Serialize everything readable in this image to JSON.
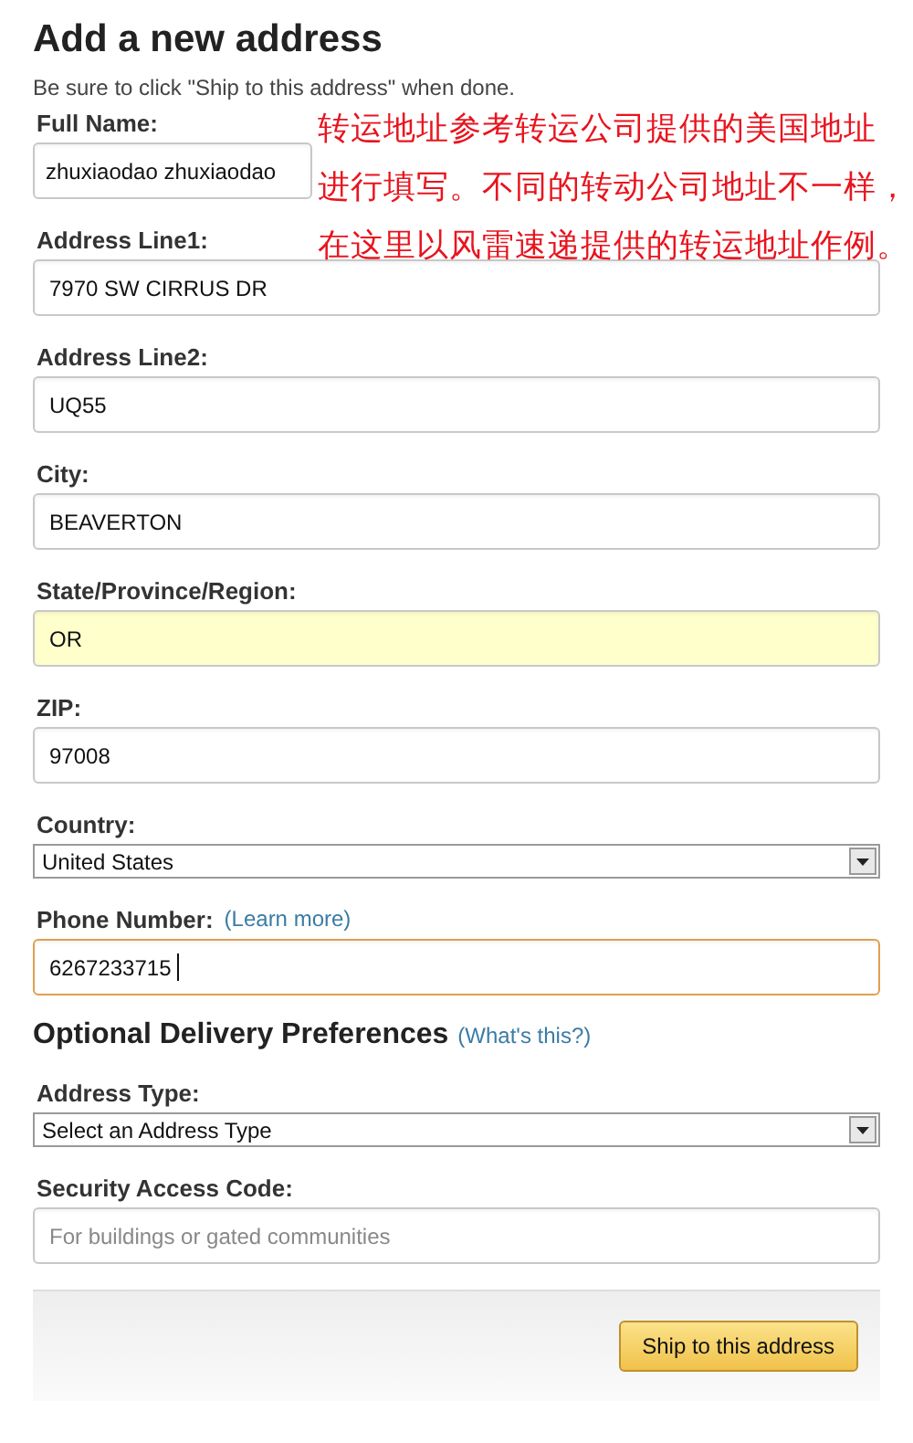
{
  "title": "Add a new address",
  "subtitle": "Be sure to click \"Ship to this address\" when done.",
  "fields": [
    {
      "kind": "text",
      "label": "Full Name:",
      "value": "zhuxiaodao zhuxiaodao",
      "highlighted": false,
      "focused": false
    },
    {
      "kind": "text",
      "label": "Address Line1:",
      "value": "7970 SW CIRRUS DR",
      "highlighted": false,
      "focused": false
    },
    {
      "kind": "text",
      "label": "Address Line2:",
      "value": "UQ55",
      "highlighted": false,
      "focused": false
    },
    {
      "kind": "text",
      "label": "City:",
      "value": "BEAVERTON",
      "highlighted": false,
      "focused": false
    },
    {
      "kind": "text",
      "label": "State/Province/Region:",
      "value": "OR",
      "highlighted": true,
      "focused": false
    },
    {
      "kind": "text",
      "label": "ZIP:",
      "value": "97008",
      "highlighted": false,
      "focused": false
    },
    {
      "kind": "select",
      "label": "Country:",
      "value": "United States"
    },
    {
      "kind": "text",
      "label": "Phone Number:",
      "link": "(Learn more)",
      "value": "6267233715",
      "highlighted": false,
      "focused": true
    }
  ],
  "optional": {
    "title": "Optional Delivery Preferences",
    "link": "(What's this?)",
    "fields": [
      {
        "kind": "select",
        "label": "Address Type:",
        "value": "Select an Address Type"
      },
      {
        "kind": "text",
        "label": "Security Access Code:",
        "placeholder": "For buildings or gated communities",
        "highlighted": false,
        "focused": false
      }
    ]
  },
  "submit": "Ship to this address",
  "annotation": [
    "转运地址参考转运公司提供的美国地址",
    "进行填写。不同的转动公司地址不一样，",
    "在这里以风雷速递提供的转运地址作例。"
  ]
}
